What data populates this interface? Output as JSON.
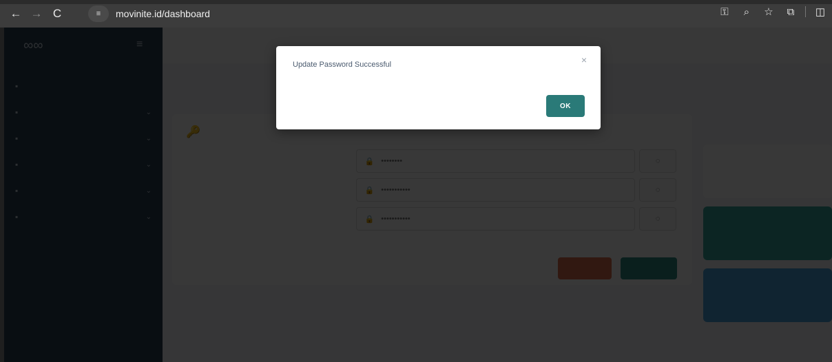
{
  "browser": {
    "back_icon": "←",
    "forward_icon": "→",
    "reload_icon": "C",
    "site_info_icon": "≡",
    "url": "movinite.id/dashboard",
    "key_icon": "⚿",
    "zoom_icon": "⌕",
    "star_icon": "☆",
    "extensions_icon": "⧉",
    "sidepanel_icon": "◫"
  },
  "app": {
    "menu_icon": "≡"
  },
  "form": {
    "title_icon": "🔑",
    "mask_current": "••••••••",
    "mask_new": "•••••••••••",
    "mask_confirm": "•••••••••••",
    "eye_icon": "◌"
  },
  "modal": {
    "message": "Update Password Successful",
    "close": "×",
    "ok_label": "OK"
  },
  "colors": {
    "accent": "#2a7a78",
    "danger": "#e07050"
  }
}
